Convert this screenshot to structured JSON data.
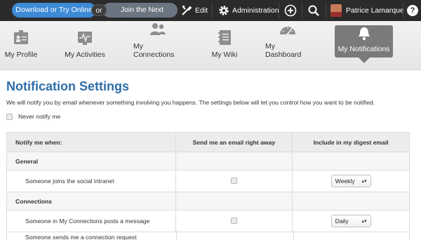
{
  "topbar": {
    "download_label": "Download or Try Online",
    "or_label": "or",
    "webinar_label": "Join the Next Webinar",
    "edit_label": "Edit",
    "admin_label": "Administration",
    "user_name": "Patrice Lamarque",
    "help_label": "?"
  },
  "nav": {
    "items": [
      {
        "label": "My Profile",
        "icon": "profile-icon"
      },
      {
        "label": "My Activities",
        "icon": "activities-icon"
      },
      {
        "label": "My Connections",
        "icon": "connections-icon"
      },
      {
        "label": "My Wiki",
        "icon": "wiki-icon"
      },
      {
        "label": "My Dashboard",
        "icon": "dashboard-icon"
      },
      {
        "label": "My Notifications",
        "icon": "bell-icon",
        "active": true
      }
    ]
  },
  "page": {
    "title": "Notification Settings",
    "intro": "We will notify you by email whenever something involving you happens. The settings below will let you control how you want to be notified.",
    "never_label": "Never notify me"
  },
  "table": {
    "headers": [
      "Notify me when:",
      "Send me an email right away",
      "Include in my digest email"
    ],
    "sections": [
      {
        "title": "General",
        "rows": [
          {
            "label": "Someone joins the social intranet",
            "digest": "Weekly"
          }
        ]
      },
      {
        "title": "Connections",
        "rows": [
          {
            "label": "Someone in My Connections posts a message",
            "digest": "Daily"
          }
        ]
      }
    ],
    "cut_row_label": "Someone sends me a connection request"
  },
  "colors": {
    "title": "#2e6ea8",
    "accent": "#3d8ad6",
    "topbar": "#2b2b2b"
  }
}
